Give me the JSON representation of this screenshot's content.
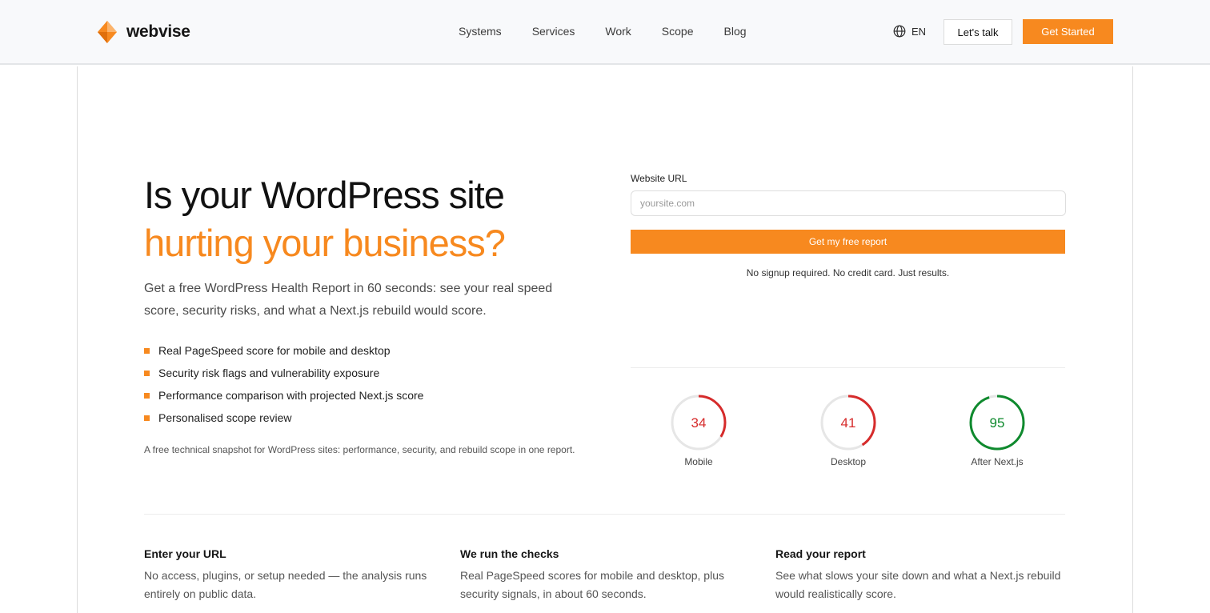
{
  "header": {
    "brand": "webvise",
    "nav": [
      "Systems",
      "Services",
      "Work",
      "Scope",
      "Blog"
    ],
    "language": "EN",
    "talk_label": "Let's talk",
    "start_label": "Get Started"
  },
  "colors": {
    "accent": "#f7891f",
    "poor": "#d62b2b",
    "good": "#0f8a2e"
  },
  "hero": {
    "title_line1": "Is your WordPress site",
    "title_line2": "hurting your business?",
    "subtitle": "Get a free WordPress Health Report in 60 seconds: see your real speed score, security risks, and what a Next.js rebuild would score.",
    "checks": [
      "Real PageSpeed score for mobile and desktop",
      "Security risk flags and vulnerability exposure",
      "Performance comparison with projected Next.js score",
      "Personalised scope review"
    ],
    "snapshot": "A free technical snapshot for WordPress sites: performance, security, and rebuild scope in one report."
  },
  "form": {
    "label": "Website URL",
    "value": "",
    "placeholder": "yoursite.com",
    "submit_label": "Get my free report",
    "note": "No signup required. No credit card. Just results."
  },
  "scores": [
    {
      "value": 34,
      "label": "Mobile",
      "color": "#d62b2b"
    },
    {
      "value": 41,
      "label": "Desktop",
      "color": "#d62b2b"
    },
    {
      "value": 95,
      "label": "After Next.js",
      "color": "#0f8a2e"
    }
  ],
  "steps": [
    {
      "title": "Enter your URL",
      "text": "No access, plugins, or setup needed — the analysis runs entirely on public data."
    },
    {
      "title": "We run the checks",
      "text": "Real PageSpeed scores for mobile and desktop, plus security signals, in about 60 seconds."
    },
    {
      "title": "Read your report",
      "text": "See what slows your site down and what a Next.js rebuild would realistically score."
    }
  ]
}
